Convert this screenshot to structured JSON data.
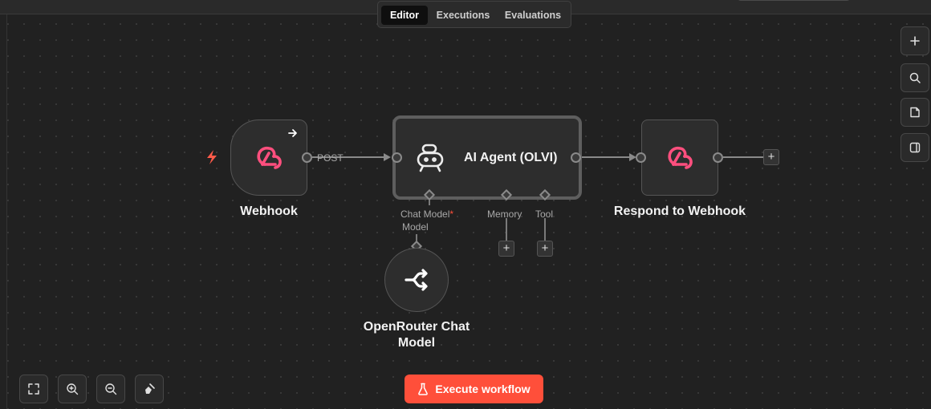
{
  "tabs": [
    {
      "label": "Editor",
      "active": true
    },
    {
      "label": "Executions",
      "active": false
    },
    {
      "label": "Evaluations",
      "active": false
    }
  ],
  "nodes": {
    "webhook": {
      "label": "Webhook",
      "output_label": "POST",
      "icon": "webhook-icon"
    },
    "agent": {
      "label": "AI Agent (OLVI)",
      "icon": "robot-icon"
    },
    "respond": {
      "label": "Respond to Webhook",
      "icon": "webhook-icon"
    },
    "openrouter": {
      "label_line1": "OpenRouter Chat",
      "label_line2": "Model",
      "icon": "openrouter-icon"
    }
  },
  "agent_inputs": {
    "chat_model": "Chat Model",
    "required_mark": "*",
    "memory": "Memory",
    "tool": "Tool"
  },
  "openrouter_output_label": "Model",
  "toolbar_right": [
    "plus-icon",
    "search-icon",
    "sticky-note-icon",
    "panel-icon"
  ],
  "toolbar_bottom": [
    "fit-view-icon",
    "zoom-in-icon",
    "zoom-out-icon",
    "tidy-up-icon"
  ],
  "execute_button": {
    "label": "Execute workflow"
  },
  "colors": {
    "accent": "#ff4f3a",
    "webhook_pink": "#ff4f7e",
    "trigger_bolt": "#ff5b4a",
    "canvas": "#212121"
  }
}
